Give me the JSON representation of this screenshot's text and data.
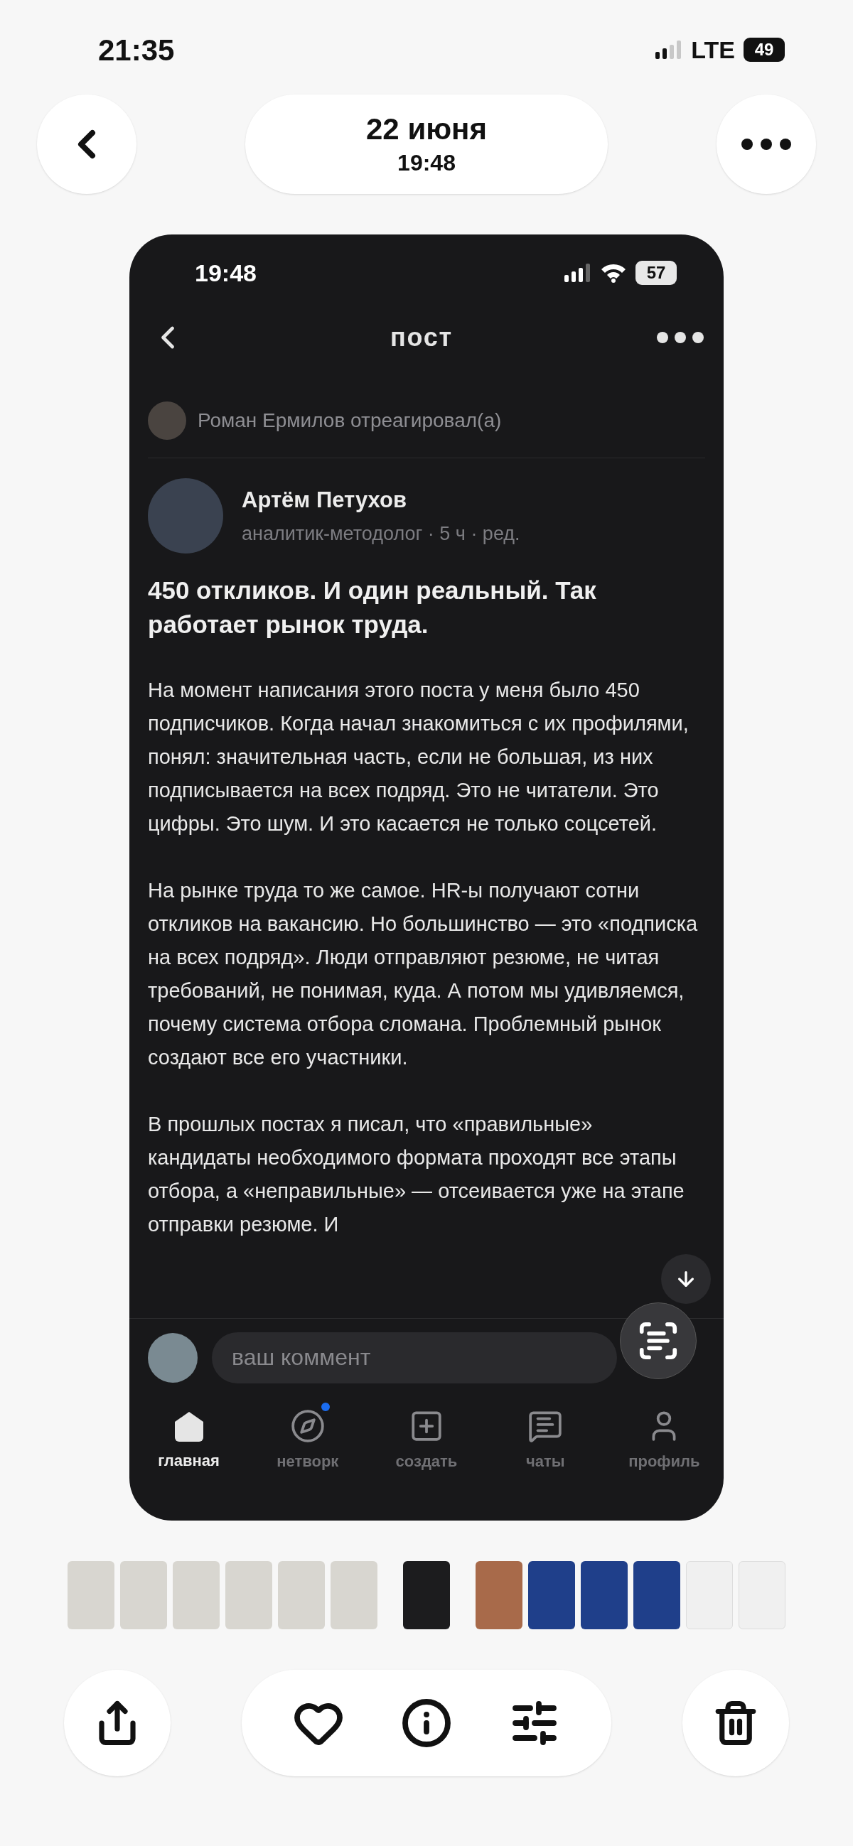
{
  "status_bar": {
    "time": "21:35",
    "network": "LTE",
    "battery": "49"
  },
  "header": {
    "date": "22 июня",
    "time": "19:48"
  },
  "screenshot": {
    "status_bar": {
      "time": "19:48",
      "battery": "57"
    },
    "title": "пост",
    "reaction": "Роман Ермилов отреагировал(а)",
    "author": {
      "name": "Артём Петухов",
      "meta": "аналитик-методолог · 5 ч · ред."
    },
    "post": {
      "title": "450 откликов. И один реальный. Так работает рынок труда.",
      "paragraphs": [
        "На момент написания этого поста у меня было 450 подписчиков. Когда начал знакомиться с их профилями, понял: значительная часть, если не большая, из них подписывается на всех подряд. Это не читатели. Это цифры. Это шум. И это касается не только соцсетей.",
        "На рынке труда то же самое. HR-ы получают сотни откликов на вакансию. Но большинство — это «подписка на всех подряд». Люди отправляют резюме, не читая требований, не понимая, куда. А потом мы удивляемся, почему система отбора сломана. Проблемный рынок создают все его участники.",
        "В прошлых постах я писал, что «правильные» кандидаты необходимого формата проходят все этапы отбора, а «неправильные» — отсеивается уже на этапе отправки резюме. И"
      ]
    },
    "comment": {
      "placeholder": "ваш коммент"
    },
    "tabs": [
      {
        "label": "главная",
        "selected": true,
        "badge": false
      },
      {
        "label": "нетворк",
        "selected": false,
        "badge": true
      },
      {
        "label": "создать",
        "selected": false,
        "badge": false
      },
      {
        "label": "чаты",
        "selected": false,
        "badge": false
      },
      {
        "label": "профиль",
        "selected": false,
        "badge": false
      }
    ]
  }
}
